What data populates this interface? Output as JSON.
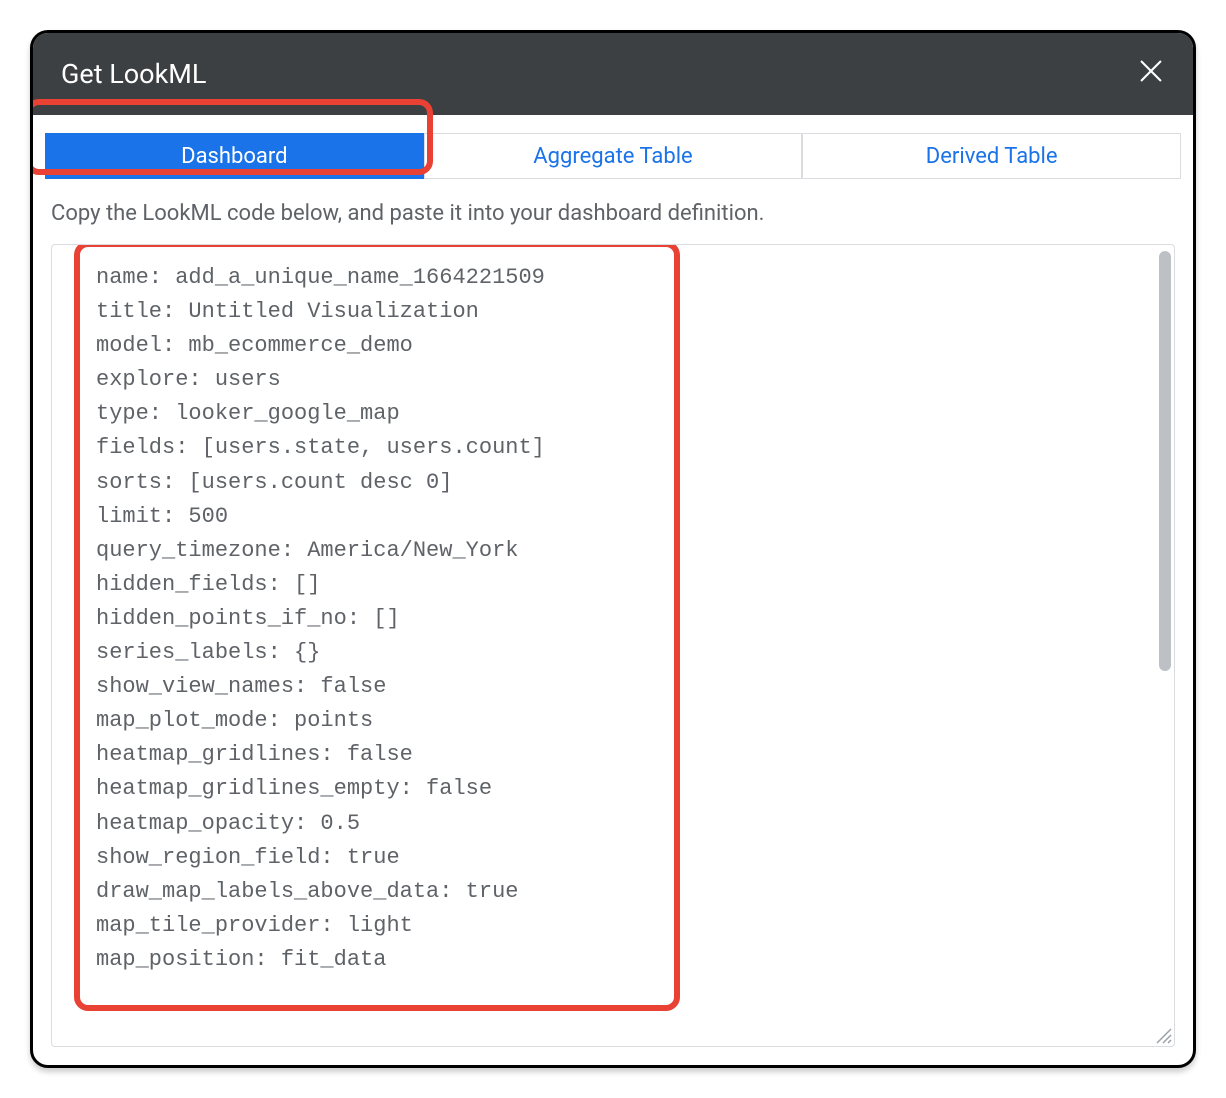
{
  "modal": {
    "title": "Get LookML"
  },
  "tabs": {
    "dashboard": "Dashboard",
    "aggregate": "Aggregate Table",
    "derived": "Derived Table"
  },
  "instruction": "Copy the LookML code below, and paste it into your dashboard definition.",
  "code": "name: add_a_unique_name_1664221509\ntitle: Untitled Visualization\nmodel: mb_ecommerce_demo\nexplore: users\ntype: looker_google_map\nfields: [users.state, users.count]\nsorts: [users.count desc 0]\nlimit: 500\nquery_timezone: America/New_York\nhidden_fields: []\nhidden_points_if_no: []\nseries_labels: {}\nshow_view_names: false\nmap_plot_mode: points\nheatmap_gridlines: false\nheatmap_gridlines_empty: false\nheatmap_opacity: 0.5\nshow_region_field: true\ndraw_map_labels_above_data: true\nmap_tile_provider: light\nmap_position: fit_data"
}
